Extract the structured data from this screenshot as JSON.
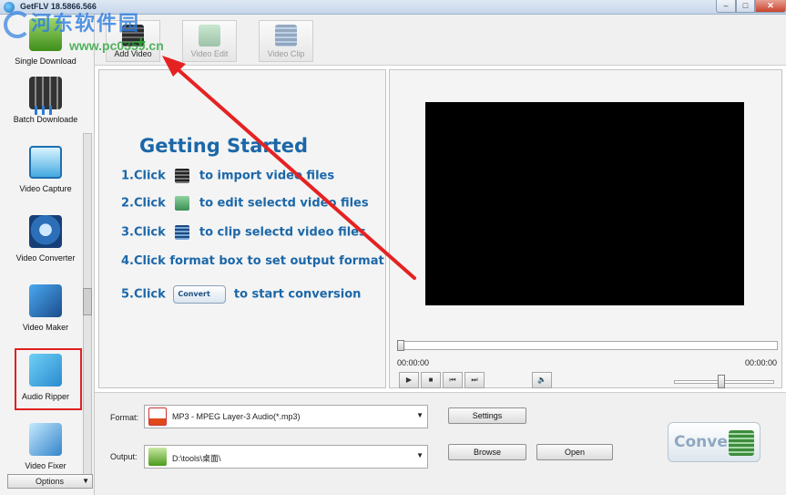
{
  "window": {
    "title": "GetFLV 18.5866.566",
    "minimize_glyph": "–",
    "maximize_glyph": "□",
    "close_glyph": "✕"
  },
  "watermark": {
    "text": "河东软件园",
    "url": "www.pc0359.cn"
  },
  "sidebar": {
    "items": [
      {
        "label": "Single Download",
        "icon": "download-icon"
      },
      {
        "label": "Batch Downloade",
        "icon": "batch-download-icon"
      },
      {
        "label": "Video Capture",
        "icon": "video-capture-icon"
      },
      {
        "label": "Video Converter",
        "icon": "video-converter-icon"
      },
      {
        "label": "Video Maker",
        "icon": "video-maker-icon"
      },
      {
        "label": "Audio Ripper",
        "icon": "audio-ripper-icon"
      },
      {
        "label": "Video Fixer",
        "icon": "video-fixer-icon"
      }
    ],
    "options_label": "Options",
    "options_arrow": "▼",
    "highlighted": "Audio Ripper",
    "highlight_color": "#e02020"
  },
  "toolbar": {
    "add_video": "Add Video",
    "video_edit": "Video Edit",
    "video_clip": "Video Clip"
  },
  "getting_started": {
    "title": "Getting Started",
    "step1_pre": "1.Click",
    "step1_post": "to import video files",
    "step2_pre": "2.Click",
    "step2_post": "to edit selectd video files",
    "step3_pre": "3.Click",
    "step3_post": "to clip selectd video files",
    "step4": "4.Click format box to set output format",
    "step5_pre": "5.Click",
    "step5_button": "Convert",
    "step5_post": "to start conversion"
  },
  "player": {
    "time_current": "00:00:00",
    "time_total": "00:00:00",
    "play_glyph": "▶",
    "stop_glyph": "■",
    "prev_glyph": "⏮",
    "next_glyph": "⏭",
    "volume_glyph": "🔈"
  },
  "output": {
    "format_label": "Format:",
    "format_value": "MP3 - MPEG Layer-3 Audio(*.mp3)",
    "output_label": "Output:",
    "output_value": "D:\\tools\\桌面\\",
    "settings_label": "Settings",
    "browse_label": "Browse",
    "open_label": "Open",
    "convert_label": "Convert",
    "dropdown_arrow": "▼"
  },
  "annotation": {
    "arrow_color": "#e52222"
  }
}
